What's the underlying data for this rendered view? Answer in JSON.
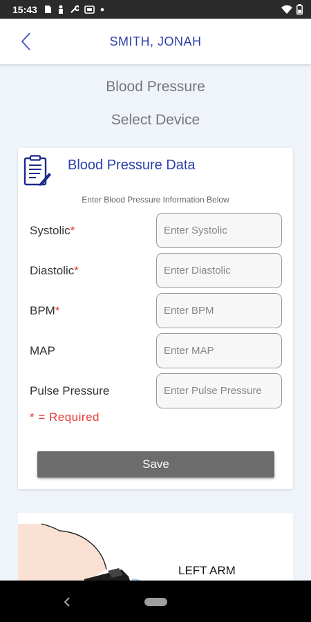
{
  "status_bar": {
    "time": "15:43",
    "icons": [
      "sim-icon",
      "person-icon",
      "wrench-icon",
      "cast-icon",
      "dot-icon"
    ],
    "right_icons": [
      "wifi-icon",
      "battery-icon"
    ]
  },
  "header": {
    "patient_name": "SMITH, JONAH"
  },
  "headings": {
    "title": "Blood Pressure",
    "subtitle": "Select Device"
  },
  "card": {
    "title": "Blood Pressure Data",
    "subtitle": "Enter Blood Pressure Information Below",
    "fields": [
      {
        "label": "Systolic",
        "required_mark": "*",
        "placeholder": "Enter Systolic",
        "value": ""
      },
      {
        "label": "Diastolic",
        "required_mark": "*",
        "placeholder": "Enter Diastolic",
        "value": ""
      },
      {
        "label": "BPM",
        "required_mark": "*",
        "placeholder": "Enter BPM",
        "value": ""
      },
      {
        "label": "MAP",
        "required_mark": "",
        "placeholder": "Enter MAP",
        "value": ""
      },
      {
        "label": "Pulse Pressure",
        "required_mark": "",
        "placeholder": "Enter Pulse Pressure",
        "value": ""
      }
    ],
    "required_note": "*  =  Required",
    "save_label": "Save"
  },
  "arm_image": {
    "label": "LEFT ARM"
  },
  "colors": {
    "accent": "#2c3fa8",
    "required": "#e53935",
    "button": "#6c6c6c",
    "background": "#eef4fa"
  }
}
